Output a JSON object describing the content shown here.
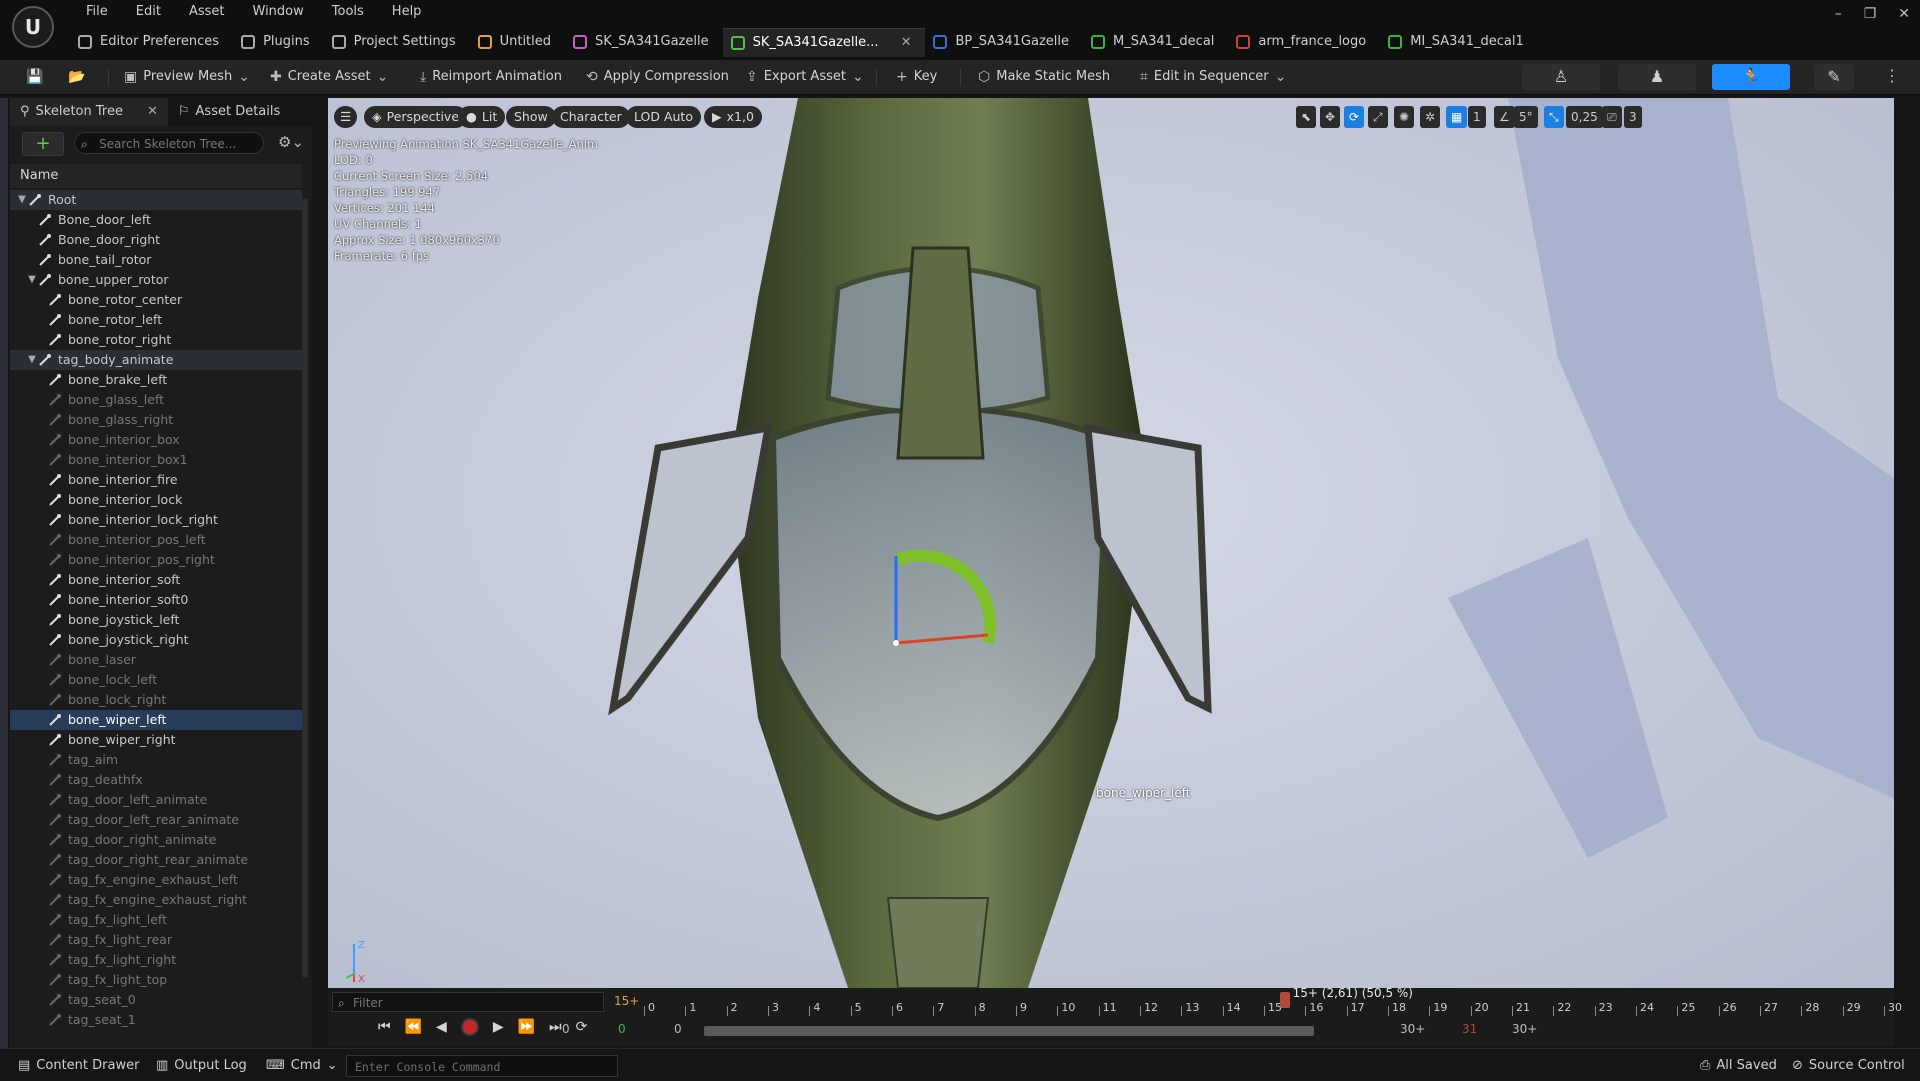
{
  "menu": [
    "File",
    "Edit",
    "Asset",
    "Window",
    "Tools",
    "Help"
  ],
  "tabs": [
    {
      "label": "Editor Preferences",
      "icon": "sliders-icon"
    },
    {
      "label": "Plugins",
      "icon": "plug-icon"
    },
    {
      "label": "Project Settings",
      "icon": "gear-icon"
    },
    {
      "label": "Untitled",
      "icon": "level-icon"
    },
    {
      "label": "SK_SA341Gazelle",
      "icon": "skeleton-icon"
    },
    {
      "label": "SK_SA341Gazelle...",
      "icon": "anim-icon",
      "active": true
    },
    {
      "label": "BP_SA341Gazelle",
      "icon": "blueprint-icon"
    },
    {
      "label": "M_SA341_decal",
      "icon": "material-icon"
    },
    {
      "label": "arm_france_logo",
      "icon": "texture-icon"
    },
    {
      "label": "MI_SA341_decal1",
      "icon": "material-instance-icon"
    }
  ],
  "toolbar": {
    "preview_mesh": "Preview Mesh",
    "create_asset": "Create Asset",
    "reimport": "Reimport Animation",
    "apply_compression": "Apply Compression",
    "export_asset": "Export Asset",
    "key": "Key",
    "make_static_mesh": "Make Static Mesh",
    "edit_in_sequencer": "Edit in Sequencer"
  },
  "left_panel": {
    "tab_skeleton": "Skeleton Tree",
    "tab_details": "Asset Details",
    "search_placeholder": "Search Skeleton Tree...",
    "column_name": "Name"
  },
  "tree": [
    {
      "label": "Root",
      "depth": 0,
      "expand": "open",
      "state": "hl"
    },
    {
      "label": "Bone_door_left",
      "depth": 1
    },
    {
      "label": "Bone_door_right",
      "depth": 1
    },
    {
      "label": "bone_tail_rotor",
      "depth": 1
    },
    {
      "label": "bone_upper_rotor",
      "depth": 1,
      "expand": "open"
    },
    {
      "label": "bone_rotor_center",
      "depth": 2
    },
    {
      "label": "bone_rotor_left",
      "depth": 2
    },
    {
      "label": "bone_rotor_right",
      "depth": 2
    },
    {
      "label": "tag_body_animate",
      "depth": 1,
      "expand": "open",
      "state": "hl"
    },
    {
      "label": "bone_brake_left",
      "depth": 2
    },
    {
      "label": "bone_glass_left",
      "depth": 2,
      "dim": true
    },
    {
      "label": "bone_glass_right",
      "depth": 2,
      "dim": true
    },
    {
      "label": "bone_interior_box",
      "depth": 2,
      "dim": true
    },
    {
      "label": "bone_interior_box1",
      "depth": 2,
      "dim": true
    },
    {
      "label": "bone_interior_fire",
      "depth": 2
    },
    {
      "label": "bone_interior_lock",
      "depth": 2
    },
    {
      "label": "bone_interior_lock_right",
      "depth": 2
    },
    {
      "label": "bone_interior_pos_left",
      "depth": 2,
      "dim": true
    },
    {
      "label": "bone_interior_pos_right",
      "depth": 2,
      "dim": true
    },
    {
      "label": "bone_interior_soft",
      "depth": 2
    },
    {
      "label": "bone_interior_soft0",
      "depth": 2
    },
    {
      "label": "bone_joystick_left",
      "depth": 2
    },
    {
      "label": "bone_joystick_right",
      "depth": 2
    },
    {
      "label": "bone_laser",
      "depth": 2,
      "dim": true
    },
    {
      "label": "bone_lock_left",
      "depth": 2,
      "dim": true
    },
    {
      "label": "bone_lock_right",
      "depth": 2,
      "dim": true
    },
    {
      "label": "bone_wiper_left",
      "depth": 2,
      "state": "sel"
    },
    {
      "label": "bone_wiper_right",
      "depth": 2
    },
    {
      "label": "tag_aim",
      "depth": 2,
      "dim": true
    },
    {
      "label": "tag_deathfx",
      "depth": 2,
      "dim": true
    },
    {
      "label": "tag_door_left_animate",
      "depth": 2,
      "dim": true
    },
    {
      "label": "tag_door_left_rear_animate",
      "depth": 2,
      "dim": true
    },
    {
      "label": "tag_door_right_animate",
      "depth": 2,
      "dim": true
    },
    {
      "label": "tag_door_right_rear_animate",
      "depth": 2,
      "dim": true
    },
    {
      "label": "tag_fx_engine_exhaust_left",
      "depth": 2,
      "dim": true
    },
    {
      "label": "tag_fx_engine_exhaust_right",
      "depth": 2,
      "dim": true
    },
    {
      "label": "tag_fx_light_left",
      "depth": 2,
      "dim": true
    },
    {
      "label": "tag_fx_light_rear",
      "depth": 2,
      "dim": true
    },
    {
      "label": "tag_fx_light_right",
      "depth": 2,
      "dim": true
    },
    {
      "label": "tag_fx_light_top",
      "depth": 2,
      "dim": true
    },
    {
      "label": "tag_seat_0",
      "depth": 2,
      "dim": true
    },
    {
      "label": "tag_seat_1",
      "depth": 2,
      "dim": true
    }
  ],
  "viewport": {
    "perspective": "Perspective",
    "lit": "Lit",
    "show": "Show",
    "character": "Character",
    "lod": "LOD Auto",
    "speed": "x1,0",
    "grid_value": "1",
    "angle_value": "5°",
    "scale_value": "0,25",
    "camera_speed": "3",
    "stats": [
      "Previewing Animation SK_SA341Gazelle_Anim",
      "LOD: 0",
      "Current Screen Size: 2,504",
      "Triangles: 199 947",
      "Vertices: 201 144",
      "UV Channels: 1",
      "Approx Size: 1 080x960x370",
      "Framerate: 6 fps"
    ],
    "bone_label": "bone_wiper_left"
  },
  "timeline": {
    "filter_placeholder": "Filter",
    "frame_count": "15+",
    "playhead_info": "15+ (2,61) (50,5 %)",
    "playhead_frame": 15.5,
    "range_start": "0",
    "range_mid1": "0",
    "range_mid2": "0",
    "range_end1": "30+",
    "range_end2": "31",
    "range_end3": "30+",
    "ticks": [
      0,
      1,
      2,
      3,
      4,
      5,
      6,
      7,
      8,
      9,
      10,
      11,
      12,
      13,
      14,
      15,
      16,
      17,
      18,
      19,
      20,
      21,
      22,
      23,
      24,
      25,
      26,
      27,
      28,
      29,
      30
    ]
  },
  "statusbar": {
    "content_drawer": "Content Drawer",
    "output_log": "Output Log",
    "cmd": "Cmd",
    "console_placeholder": "Enter Console Command",
    "all_saved": "All Saved",
    "source_control": "Source Control"
  },
  "colors": {
    "accent": "#1a8cff",
    "selection": "#263c59",
    "record": "#c62828",
    "add_green": "#5ecb4d"
  }
}
